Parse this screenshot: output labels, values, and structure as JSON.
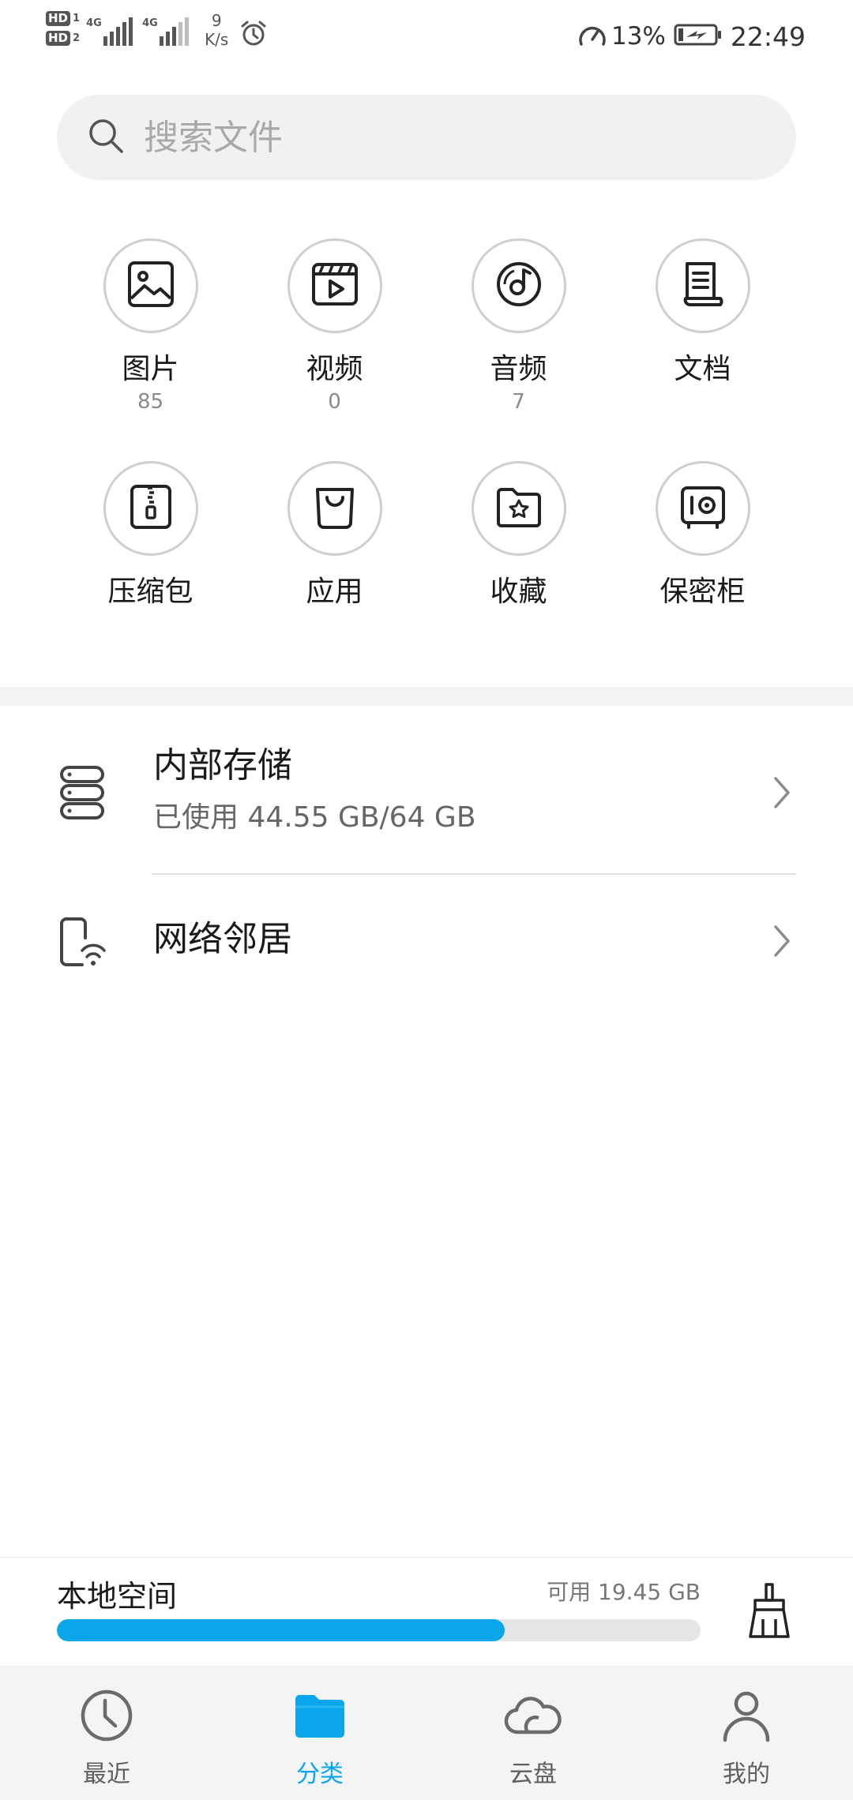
{
  "status_bar": {
    "sim1": "HD",
    "sim1_num": "1",
    "sim2": "HD",
    "sim2_num": "2",
    "net1": "4G",
    "net2": "4G",
    "speed_value": "9",
    "speed_unit": "K/s",
    "battery_percent": "13%",
    "time": "22:49",
    "icons": [
      "alarm-icon",
      "speedometer-icon",
      "battery-charging-icon"
    ]
  },
  "search": {
    "placeholder": "搜索文件",
    "icon": "search-icon"
  },
  "categories": [
    {
      "name": "图片",
      "count": "85",
      "icon": "image-icon"
    },
    {
      "name": "视频",
      "count": "0",
      "icon": "video-icon"
    },
    {
      "name": "音频",
      "count": "7",
      "icon": "music-disc-icon"
    },
    {
      "name": "文档",
      "count": "",
      "icon": "document-scroll-icon"
    },
    {
      "name": "压缩包",
      "count": "",
      "icon": "zip-icon"
    },
    {
      "name": "应用",
      "count": "",
      "icon": "shopping-bag-icon"
    },
    {
      "name": "收藏",
      "count": "",
      "icon": "star-folder-icon"
    },
    {
      "name": "保密柜",
      "count": "",
      "icon": "safe-icon"
    }
  ],
  "storage": {
    "internal_title": "内部存储",
    "internal_usage": "已使用 44.55 GB/64 GB",
    "network_title": "网络邻居"
  },
  "local_space": {
    "label": "本地空间",
    "available": "可用 19.45 GB",
    "used_fraction": 0.696,
    "bar_color": "#0aa6ec"
  },
  "nav": {
    "tabs": [
      {
        "label": "最近",
        "icon": "clock-icon",
        "active": false
      },
      {
        "label": "分类",
        "icon": "folder-icon",
        "active": true
      },
      {
        "label": "云盘",
        "icon": "cloud-icon",
        "active": false
      },
      {
        "label": "我的",
        "icon": "person-icon",
        "active": false
      }
    ],
    "active_color": "#0aa6ec"
  }
}
